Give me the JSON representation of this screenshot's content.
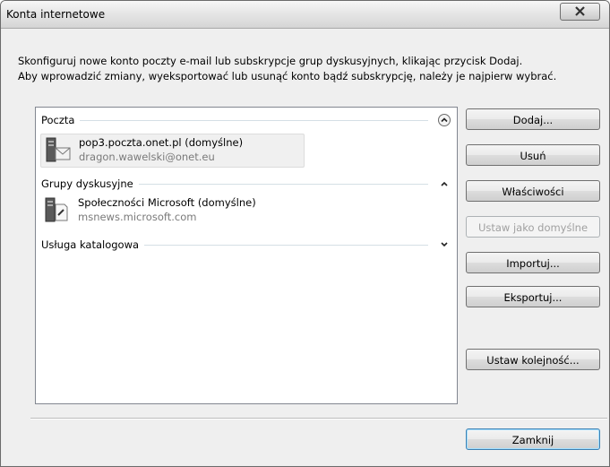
{
  "window": {
    "title": "Konta internetowe",
    "close_label": "X"
  },
  "description": {
    "line1": "Skonfiguruj nowe konto poczty e-mail lub subskrypcje grup dyskusyjnych, klikając przycisk Dodaj.",
    "line2": "Aby wprowadzić zmiany, wyeksportować lub usunąć konto bądź subskrypcję, należy je najpierw wybrać."
  },
  "list": {
    "groups": [
      {
        "label": "Poczta",
        "toggle": "collapse-circle",
        "accounts": [
          {
            "name": "pop3.poczta.onet.pl (domyślne)",
            "detail": "dragon.wawelski@onet.eu",
            "icon": "mail-server-icon",
            "selected": true
          }
        ]
      },
      {
        "label": "Grupy dyskusyjne",
        "toggle": "collapse",
        "accounts": [
          {
            "name": "Społeczności Microsoft (domyślne)",
            "detail": "msnews.microsoft.com",
            "icon": "news-server-icon",
            "selected": false
          }
        ]
      },
      {
        "label": "Usługa katalogowa",
        "toggle": "expand",
        "accounts": []
      }
    ]
  },
  "buttons": {
    "add": "Dodaj...",
    "remove": "Usuń",
    "properties": "Właściwości",
    "set_default": "Ustaw jako domyślne",
    "import": "Importuj...",
    "export": "Eksportuj...",
    "set_order": "Ustaw kolejność...",
    "close": "Zamknij"
  },
  "colors": {
    "accent": "#3c7fb1",
    "disabled_text": "#a0a0a0",
    "secondary_text": "#7a7a7a"
  }
}
